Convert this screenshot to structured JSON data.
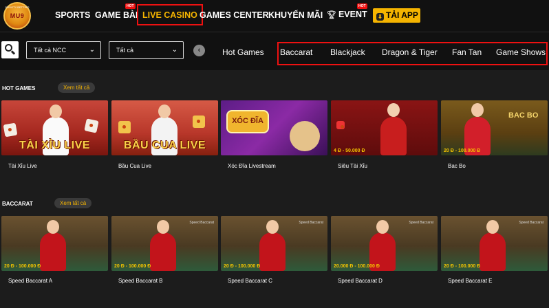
{
  "header": {
    "logo_text": "MU9",
    "logo_ring": "SHOOTY BETTING",
    "nav": [
      "SPORTS",
      "GAME BÀI",
      "LIVE CASINO",
      "GAMES CENTER",
      "KHUYẾN MÃI",
      "EVENT"
    ],
    "hot_badge": "HOT",
    "app_button": "TẢI APP"
  },
  "filters": {
    "provider_select": "Tất cả NCC",
    "type_select": "Tất cả",
    "tabs": [
      "Hot Games",
      "Baccarat",
      "Blackjack",
      "Dragon & Tiger",
      "Fan Tan",
      "Game Shows"
    ]
  },
  "hot_games": {
    "title": "HOT GAMES",
    "see_all": "Xem tất cả",
    "cards": [
      {
        "name": "Tài Xỉu Live",
        "banner": "TÀI XỈU LIVE",
        "price": ""
      },
      {
        "name": "Bầu Cua Live",
        "banner": "BẦU CUA LIVE",
        "price": ""
      },
      {
        "name": "Xóc Đĩa Livestream",
        "banner": "XÓC ĐĨA",
        "price": ""
      },
      {
        "name": "Siêu Tài Xỉu",
        "banner": "",
        "price": "4 Đ - 50.000 Đ"
      },
      {
        "name": "Bac Bo",
        "banner": "BAC BO",
        "price": "20 Đ - 100.000 Đ"
      }
    ]
  },
  "baccarat": {
    "title": "BACCARAT",
    "see_all": "Xem tất cả",
    "cards": [
      {
        "name": "Speed Baccarat A",
        "price": "20 Đ - 100.000 Đ"
      },
      {
        "name": "Speed Baccarat B",
        "price": "20 Đ - 100.000 Đ"
      },
      {
        "name": "Speed Baccarat C",
        "price": "20 Đ - 100.000 Đ"
      },
      {
        "name": "Speed Baccarat D",
        "price": "20.000 Đ - 100.000 Đ"
      },
      {
        "name": "Speed Baccarat E",
        "price": "20 Đ - 100.000 Đ"
      }
    ],
    "table_logo": "Speed Baccarat"
  },
  "colors": {
    "accent": "#f5b400",
    "hot": "#e11111",
    "background": "#1c1c1c"
  }
}
